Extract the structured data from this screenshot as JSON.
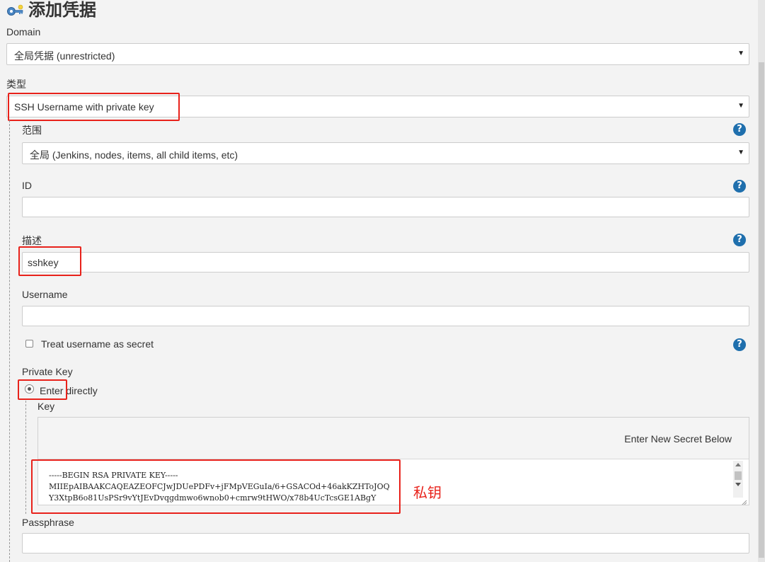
{
  "page": {
    "title": "添加凭据",
    "title_icon": "key-icon"
  },
  "domain": {
    "label": "Domain",
    "value": "全局凭据 (unrestricted)"
  },
  "kind": {
    "label": "类型",
    "value": "SSH Username with private key"
  },
  "scope": {
    "label": "范围",
    "value": "全局 (Jenkins, nodes, items, all child items, etc)"
  },
  "id_field": {
    "label": "ID",
    "value": ""
  },
  "description": {
    "label": "描述",
    "value": "sshkey"
  },
  "username": {
    "label": "Username",
    "value": ""
  },
  "treat_secret": {
    "label": "Treat username as secret",
    "checked": false
  },
  "private_key": {
    "label": "Private Key",
    "option_label": "Enter directly",
    "key_label": "Key",
    "secret_hint": "Enter New Secret Below",
    "lines": [
      "-----BEGIN RSA PRIVATE KEY-----",
      "MIIEpAIBAAKCAQEAZEOFCJwJDUePDFv+jFMpVEGuIa/6+GSACOd+46akKZHToJOQ",
      "Y3XtpB6o81UsPSr9vYtJEvDvqgdmwo6wnob0+cmrw9tHWO/x78b4UcTcsGE1ABgY"
    ]
  },
  "annotation": {
    "text": "私钥",
    "color": "#e8221b"
  },
  "passphrase": {
    "label": "Passphrase",
    "value": ""
  },
  "help_icon_glyph": "?",
  "caret_glyph": "▼"
}
